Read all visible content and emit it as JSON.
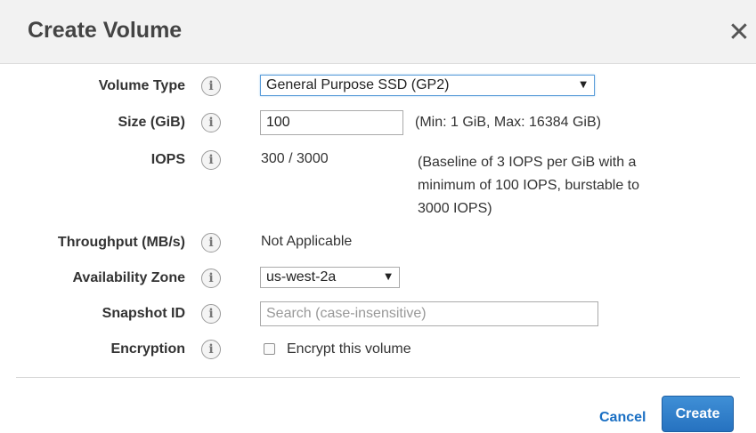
{
  "dialog": {
    "title": "Create Volume",
    "close_glyph": "✕"
  },
  "info_glyph": "i",
  "fields": {
    "volume_type": {
      "label": "Volume Type",
      "value": "General Purpose SSD (GP2)"
    },
    "size": {
      "label": "Size (GiB)",
      "value": "100",
      "hint": "(Min: 1 GiB, Max: 16384 GiB)"
    },
    "iops": {
      "label": "IOPS",
      "value": "300 / 3000",
      "hint_lines": [
        "(Baseline of 3 IOPS per GiB with a",
        "minimum of 100 IOPS, burstable to",
        "3000 IOPS)"
      ]
    },
    "throughput": {
      "label": "Throughput (MB/s)",
      "value": "Not Applicable"
    },
    "availability_zone": {
      "label": "Availability Zone",
      "value": "us-west-2a"
    },
    "snapshot": {
      "label": "Snapshot ID",
      "placeholder": "Search (case-insensitive)"
    },
    "encryption": {
      "label": "Encryption",
      "checkbox_label": "Encrypt this volume",
      "checked": false
    }
  },
  "caret_glyph": "▼",
  "footer": {
    "cancel_label": "Cancel",
    "create_label": "Create"
  },
  "colors": {
    "primary": "#2672c0",
    "link": "#1a6fc3",
    "header_bg": "#f2f2f2"
  },
  "icons": [
    "close-icon",
    "info-icon",
    "dropdown-caret-icon",
    "checkbox-icon"
  ]
}
